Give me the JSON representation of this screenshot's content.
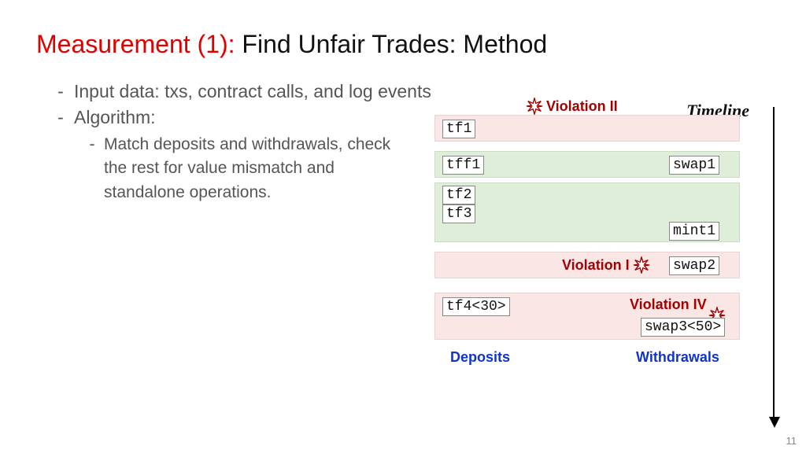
{
  "title": {
    "prefix": "Measurement (1): ",
    "rest": "Find Unfair Trades: Method"
  },
  "bullets": {
    "input": "Input data: txs, contract calls, and log events",
    "algo": "Algorithm:",
    "sub": "Match deposits and withdrawals, check the rest for value mismatch and standalone operations."
  },
  "timeline_label": "Timeline",
  "violations": {
    "v2": "Violation II",
    "v1": "Violation I",
    "v4": "Violation IV"
  },
  "codes": {
    "tf1": "tf1",
    "tff1": "tff1",
    "tf2": "tf2",
    "tf3": "tf3",
    "swap1": "swap1",
    "mint1": "mint1",
    "swap2": "swap2",
    "tf4": "tf4<30>",
    "swap3": "swap3<50>"
  },
  "footer": {
    "deposits": "Deposits",
    "withdrawals": "Withdrawals"
  },
  "page_number": "11"
}
